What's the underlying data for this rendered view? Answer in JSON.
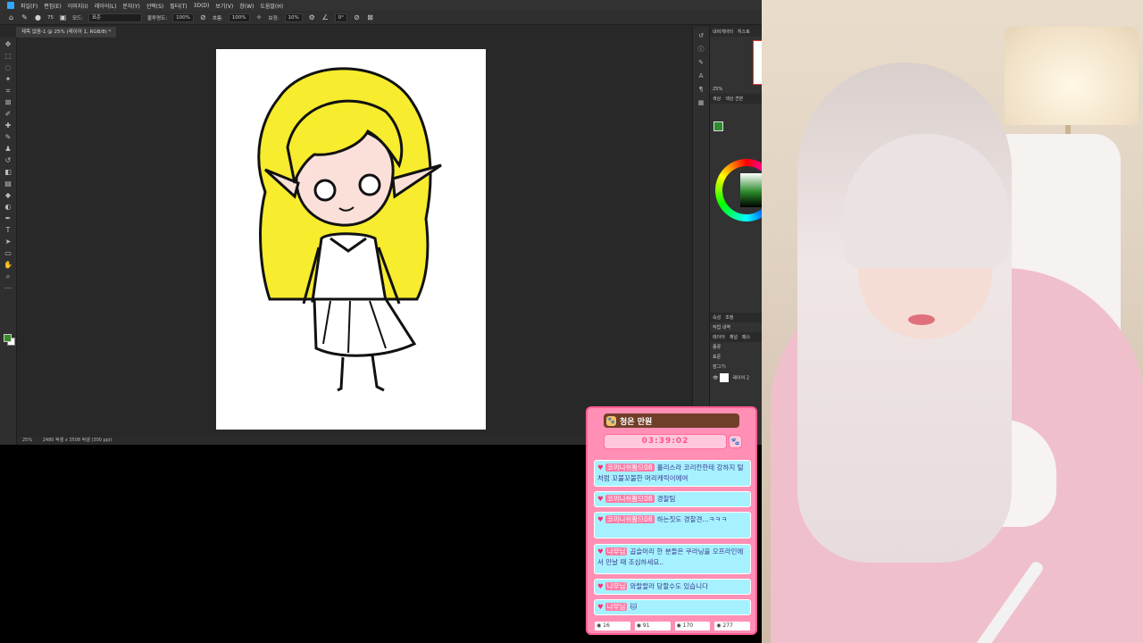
{
  "photoshop": {
    "menu": [
      "파일(F)",
      "편집(E)",
      "이미지(I)",
      "레이어(L)",
      "문자(Y)",
      "선택(S)",
      "필터(T)",
      "3D(D)",
      "보기(V)",
      "창(W)",
      "도움말(H)"
    ],
    "options": {
      "mode_label": "모드:",
      "mode_value": "표준",
      "opacity_label": "불투명도:",
      "opacity_value": "100%",
      "flow_label": "흐름:",
      "flow_value": "100%",
      "smoothing_label": "보정:",
      "smoothing_value": "10%",
      "angle_value": "0°",
      "brush_size": "75"
    },
    "document_tab": "제목 없음-1 @ 25% (레이어 1, RGB/8) *",
    "status": {
      "zoom": "25%",
      "doc_info": "2480 픽셀 x 3508 픽셀 (300 ppi)"
    },
    "panels": {
      "top_tabs": [
        "내비게이터",
        "히스토"
      ],
      "nav_zoom": "25%",
      "color_tabs": [
        "색상",
        "색상 견본"
      ],
      "prop_tabs": [
        "속성",
        "조정"
      ],
      "work_label": "작업 내역",
      "layer_tabs": [
        "레이어",
        "채널",
        "패스"
      ],
      "kind_label": "종류",
      "blend_value": "표준",
      "lock_label": "잠그기:",
      "layer_name": "레이어 2"
    }
  },
  "chat": {
    "title": "청은 만원",
    "timer": "03:39:02",
    "messages": [
      {
        "user": "코끼니쉬퐘므08",
        "text": "홀리스라 코리칸한테 강하지 털처럼 꼬불꼬불한 머리캐릭이에여"
      },
      {
        "user": "코끼니쉬퐘므08",
        "text": "경찰팀"
      },
      {
        "user": "코끼니쉬퐘므08",
        "text": "하는짓도 경찰견...ㅋㅋㅋ"
      },
      {
        "user": "나무님",
        "text": "곱슬머리 한 분들은 쿠라닝을 오프라인에서 만날 때 조심하세요.."
      },
      {
        "user": "나무님",
        "text": "와랄랄라 당할수도 있습니다"
      },
      {
        "user": "나무님",
        "text": "🐱"
      }
    ],
    "stats": [
      "16",
      "91",
      "170",
      "277"
    ]
  },
  "colors": {
    "hair": "#f7ec2d",
    "chat_bg": "#ff8fb4",
    "chat_msg": "#a6f1ff"
  }
}
